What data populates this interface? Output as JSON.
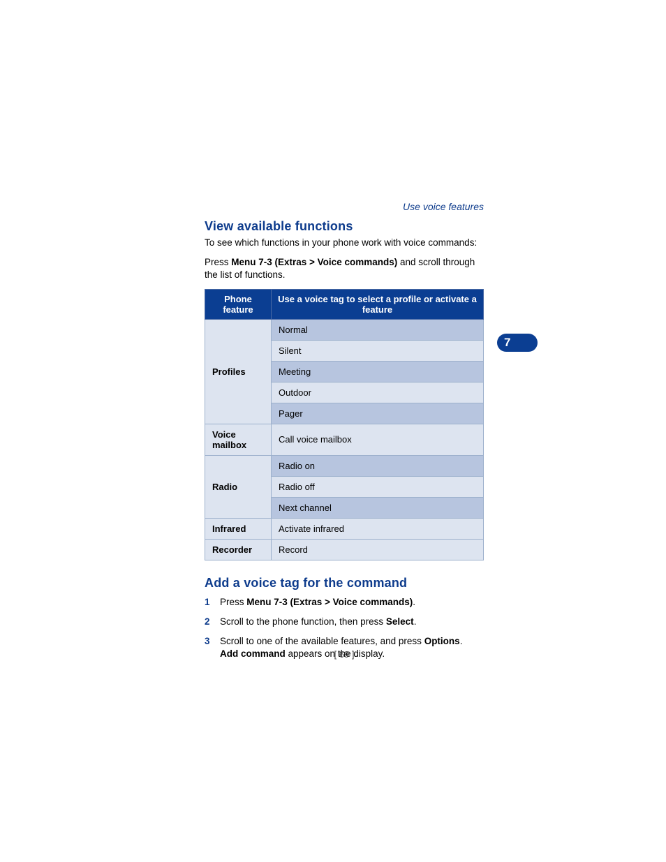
{
  "chapter_label": "Use voice features",
  "chapter_tab": "7",
  "page_number": "[ 69 ]",
  "section1": {
    "heading": "View available functions",
    "intro": "To see which functions in your phone work with voice commands:",
    "press_prefix": "Press ",
    "press_bold": "Menu 7-3 (Extras > Voice commands)",
    "press_suffix": " and scroll through the list of functions."
  },
  "table": {
    "header_left": "Phone feature",
    "header_right": "Use a voice tag to select a profile or activate a feature",
    "groups": [
      {
        "category": "Profiles",
        "items": [
          "Normal",
          "Silent",
          "Meeting",
          "Outdoor",
          "Pager"
        ]
      },
      {
        "category": "Voice mailbox",
        "items": [
          "Call voice mailbox"
        ]
      },
      {
        "category": "Radio",
        "items": [
          "Radio on",
          "Radio off",
          "Next channel"
        ]
      },
      {
        "category": "Infrared",
        "items": [
          "Activate infrared"
        ]
      },
      {
        "category": "Recorder",
        "items": [
          "Record"
        ]
      }
    ]
  },
  "section2": {
    "heading": "Add a voice tag for the command",
    "steps": [
      {
        "num": "1",
        "prefix": "Press ",
        "bold1": "Menu 7-3 (Extras > Voice commands)",
        "suffix1": "."
      },
      {
        "num": "2",
        "prefix": "Scroll to the phone function, then press ",
        "bold1": "Select",
        "suffix1": "."
      },
      {
        "num": "3",
        "prefix": "Scroll to one of the available features, and press ",
        "bold1": "Options",
        "suffix1": ".",
        "line2_bold": "Add command",
        "line2_rest": " appears on the display."
      }
    ]
  }
}
